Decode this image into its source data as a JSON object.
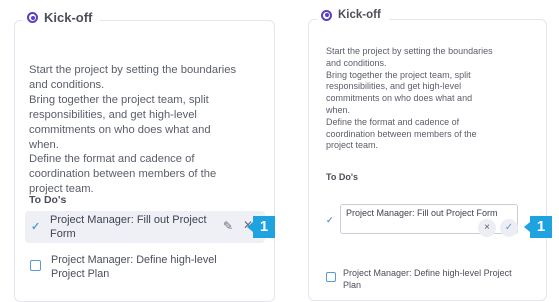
{
  "left_card": {
    "title": "Kick-off",
    "description": "Start the project by setting the boundaries\nand conditions.\nBring together the project team, split\nresponsibilities, and get high-level\ncommitments on who does what and\nwhen.\nDefine the format and cadence of\ncoordination between members of the\nproject team.",
    "todos_label": "To Do's",
    "todos": [
      {
        "text": "Project Manager: Fill out Project Form",
        "checked": true
      },
      {
        "text": "Project Manager: Define high-level Project Plan",
        "checked": false
      }
    ],
    "callout": "1"
  },
  "right_card": {
    "title": "Kick-off",
    "description": "Start the project by setting the boundaries\nand conditions.\nBring together the project team, split\nresponsibilities, and get high-level\ncommitments on who does what and\nwhen.\nDefine the format and cadence of\ncoordination between members of the\nproject team.",
    "todos_label": "To Do's",
    "editing_value": "Project Manager: Fill out Project Form",
    "todos": [
      {
        "text": "Project Manager: Define high-level Project Plan",
        "checked": false
      }
    ],
    "cancel_symbol": "×",
    "confirm_symbol": "✓",
    "callout": "1"
  },
  "colors": {
    "accent_purple": "#5b3fc4",
    "check_blue": "#5b9bd5",
    "callout_blue": "#1fa3e0"
  },
  "icons": {
    "pencil": "pencil-icon",
    "close": "close-icon",
    "check": "check-icon"
  }
}
